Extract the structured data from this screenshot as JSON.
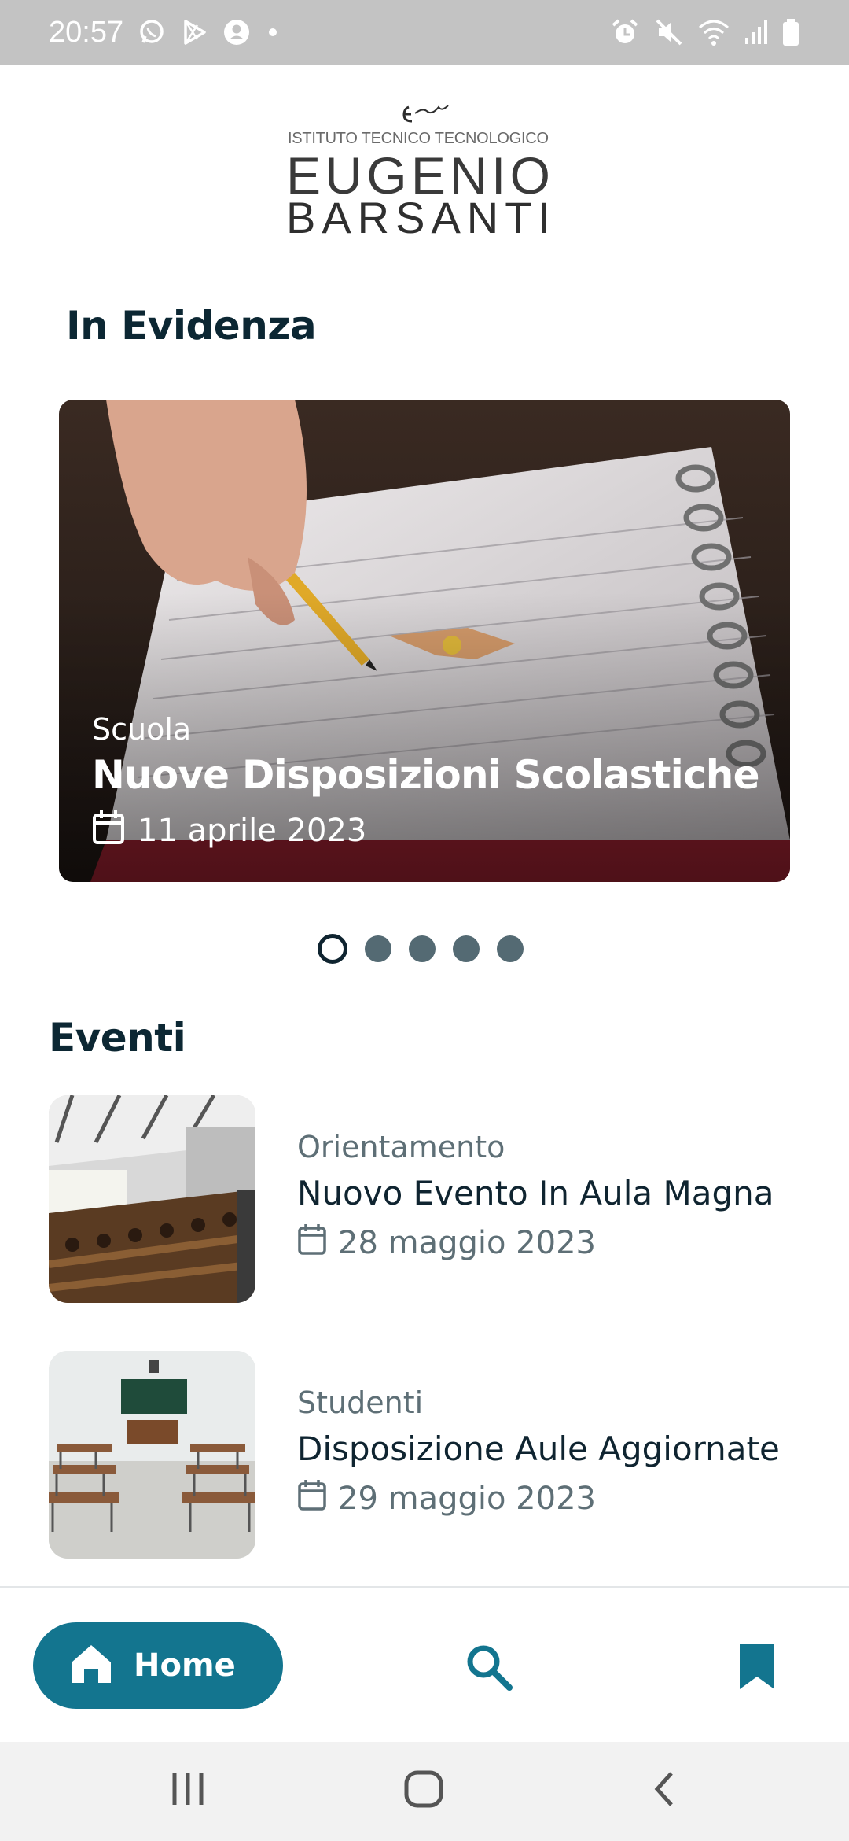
{
  "status_bar": {
    "time": "20:57",
    "left_icons": [
      "whatsapp-icon",
      "play-store-icon",
      "account-icon",
      "dot-icon"
    ],
    "right_icons": [
      "alarm-icon",
      "mute-icon",
      "wifi-icon",
      "signal-icon",
      "battery-icon"
    ]
  },
  "header": {
    "logo_lines": [
      "ISTITUTO TECNICO TECNOLOGICO",
      "EUGENIO",
      "BARSANTI"
    ]
  },
  "featured": {
    "section_title": "In Evidenza",
    "card": {
      "category": "Scuola",
      "title": "Nuove Disposizioni Scolastiche",
      "date": "11 aprile 2023"
    },
    "carousel": {
      "count": 5,
      "active_index": 0
    }
  },
  "events": {
    "section_title": "Eventi",
    "items": [
      {
        "category": "Orientamento",
        "title": "Nuovo Evento In Aula Magna",
        "date": "28 maggio 2023"
      },
      {
        "category": "Studenti",
        "title": "Disposizione Aule Aggiornate",
        "date": "29 maggio 2023"
      }
    ]
  },
  "bottom_nav": {
    "home_label": "Home",
    "items": [
      "home-icon",
      "search-icon",
      "bookmark-icon"
    ],
    "accent_color": "#13758f"
  },
  "system_nav": {
    "buttons": [
      "recent-apps-icon",
      "home-circle-icon",
      "back-icon"
    ]
  }
}
